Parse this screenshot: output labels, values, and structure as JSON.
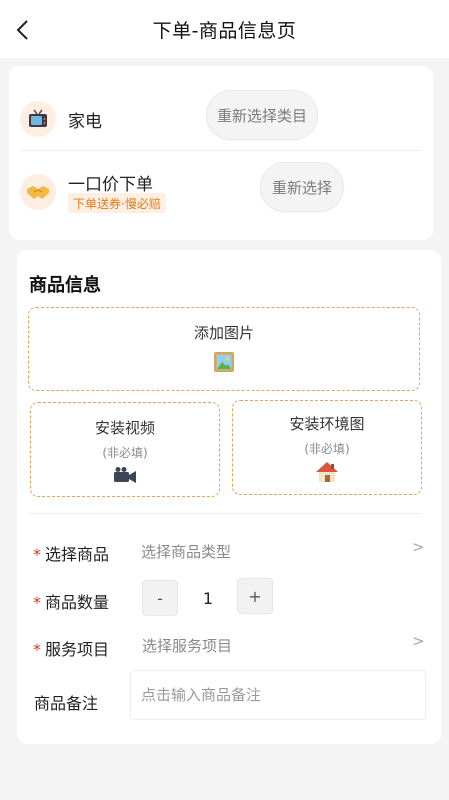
{
  "header": {
    "title": "下单-商品信息页",
    "back_icon": "chevron-left-icon"
  },
  "category": {
    "icon": "tv-icon",
    "label": "家电",
    "reselect_label": "重新选择类目"
  },
  "pricing": {
    "icon": "handshake-icon",
    "label": "一口价下单",
    "promo_tag": "下单送券·慢必赔",
    "reselect_label": "重新选择"
  },
  "product_info": {
    "title": "商品信息",
    "add_image": {
      "label": "添加图片",
      "icon": "image-icon"
    },
    "install_video": {
      "label": "安装视频",
      "sub": "(非必填)",
      "icon": "video-camera-icon"
    },
    "install_env": {
      "label": "安装环境图",
      "sub": "(非必填)",
      "icon": "house-icon"
    }
  },
  "form": {
    "required_mark": "*",
    "product": {
      "label": "选择商品",
      "value": "选择商品类型",
      "chevron": ">"
    },
    "quantity": {
      "label": "商品数量",
      "minus": "-",
      "value": "1",
      "plus": "+"
    },
    "service": {
      "label": "服务项目",
      "value": "选择服务项目",
      "chevron": ">"
    },
    "remark": {
      "label": "商品备注",
      "placeholder": "点击输入商品备注"
    }
  },
  "colors": {
    "accent": "#e57a1a",
    "required": "#d9352b",
    "dashed_border": "#e0a75a",
    "background": "#f4f4f4"
  }
}
